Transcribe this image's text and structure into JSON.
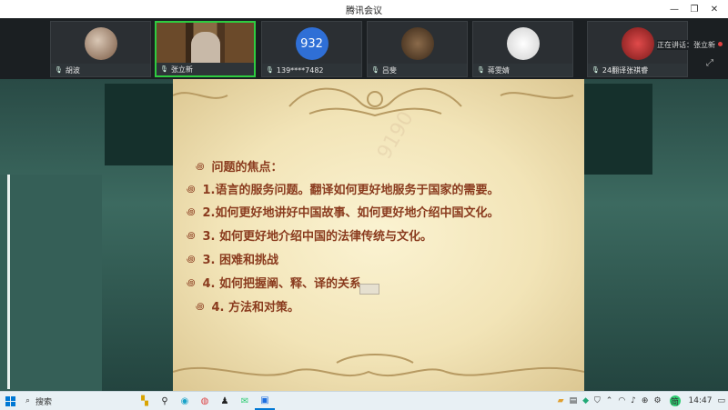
{
  "window": {
    "title": "腾讯会议",
    "controls": {
      "minimize": "—",
      "restore": "❐",
      "close": "✕"
    }
  },
  "participants": [
    {
      "name": "胡波",
      "type": "photo"
    },
    {
      "name": "张立新",
      "type": "video",
      "active": true
    },
    {
      "name": "139****7482",
      "type": "initials",
      "initials": "932"
    },
    {
      "name": "吕斐",
      "type": "photo"
    },
    {
      "name": "蒋雯婧",
      "type": "photo"
    },
    {
      "name": "24翻译张祺睿",
      "type": "photo"
    }
  ],
  "speaking": {
    "label": "正在讲话：张立新"
  },
  "slide": {
    "watermark": "9190",
    "items": [
      "问题的焦点：",
      "1.语言的服务问题。翻译如何更好地服务于国家的需要。",
      "2.如何更好地讲好中国故事、如何更好地介绍中国文化。",
      "3. 如何更好地介绍中国的法律传统与文化。",
      "3. 困难和挑战",
      "4. 如何把握阐、释、译的关系、",
      "4. 方法和对策。"
    ],
    "bullet": "꩜"
  },
  "taskbar": {
    "search_label": "搜索",
    "time": "14:47",
    "ime": "简"
  },
  "colors": {
    "accent": "#2ecc40",
    "slide_text": "#8a3b1e",
    "background": "#2f5a52"
  }
}
